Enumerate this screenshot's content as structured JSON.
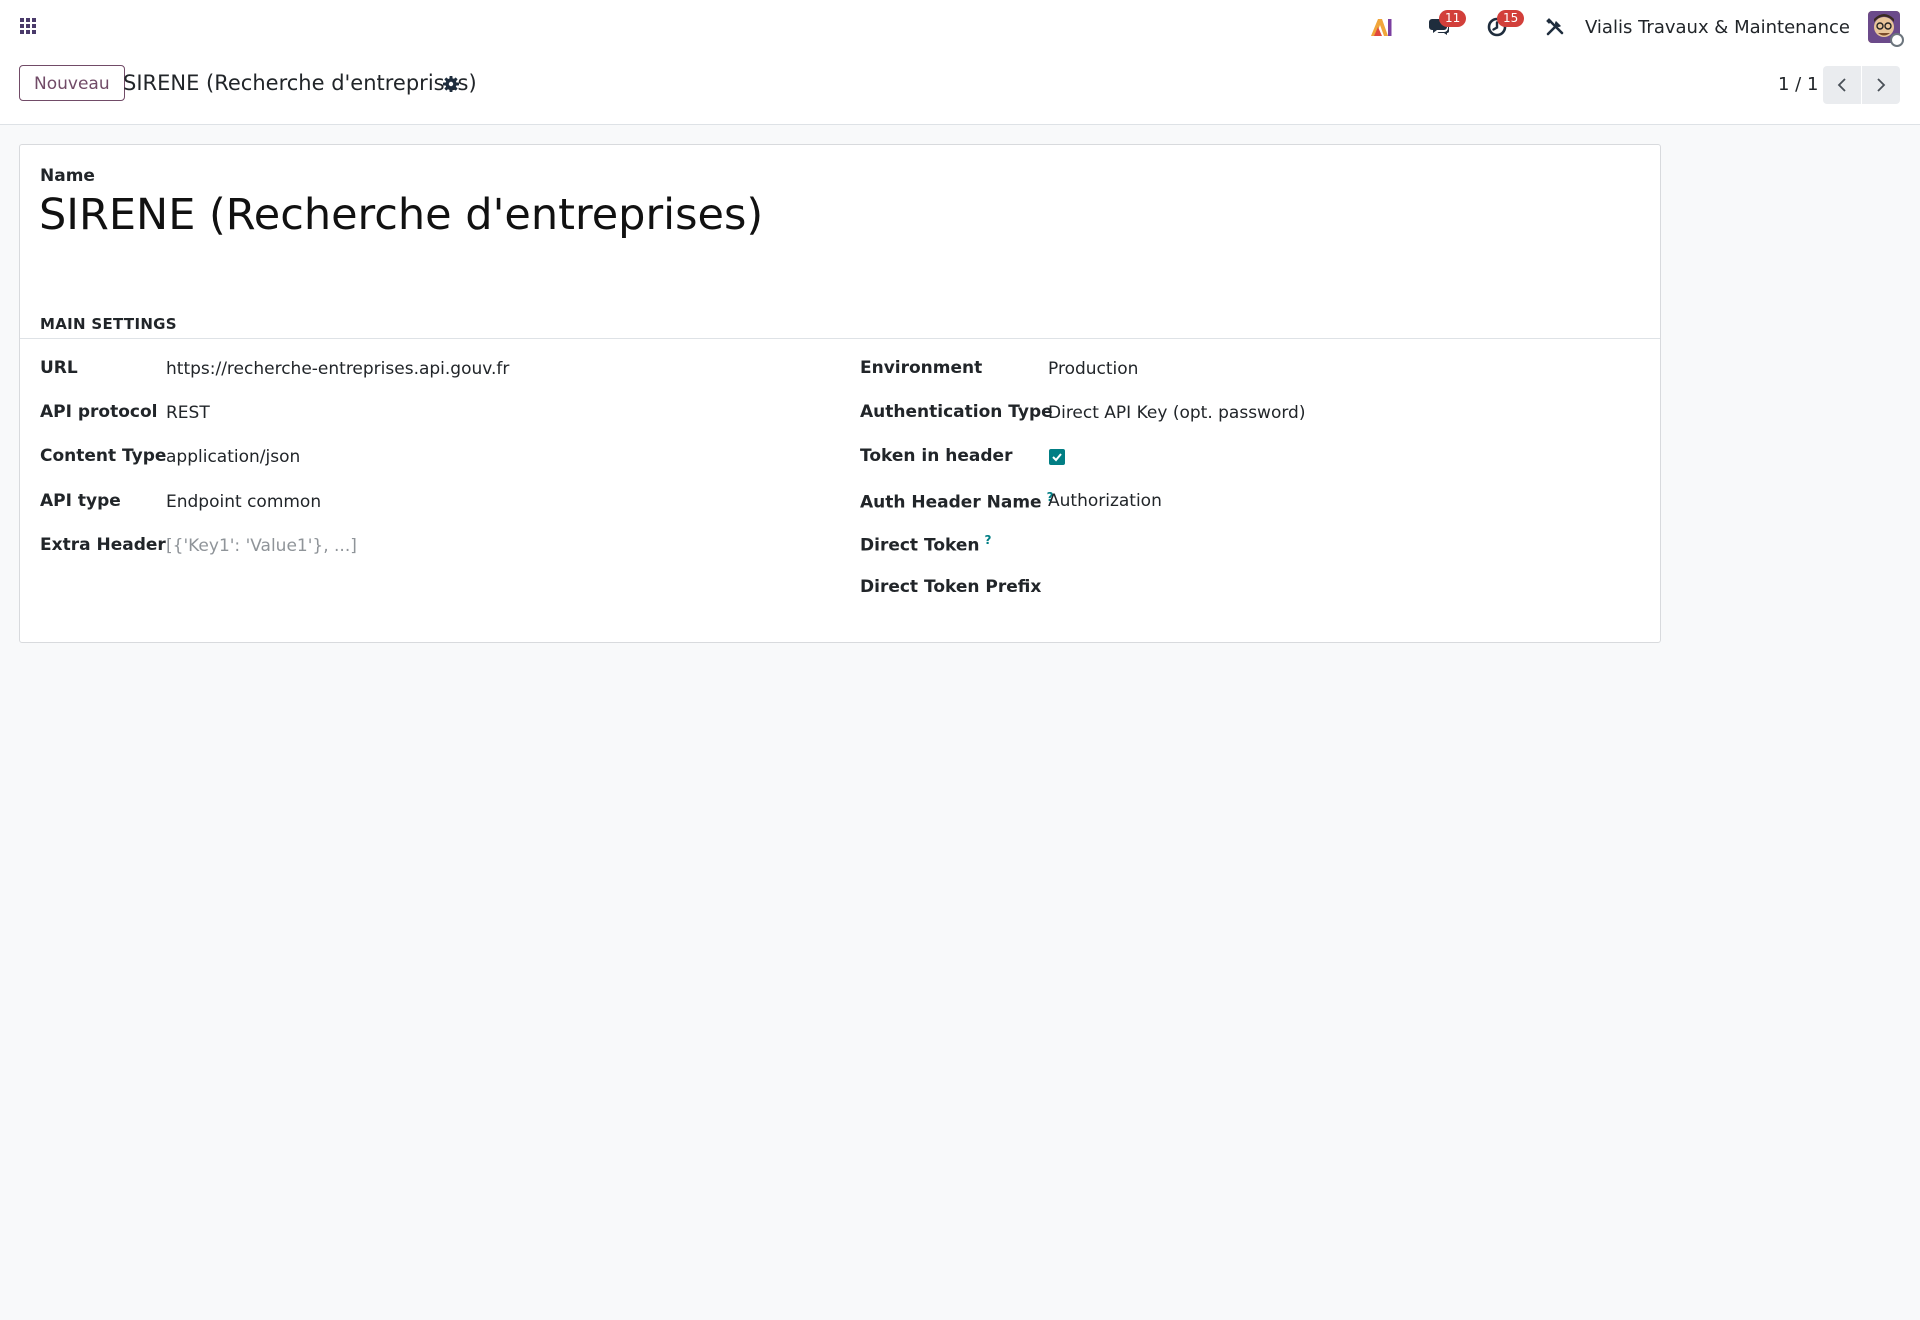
{
  "navbar": {
    "badges": {
      "messages": "11",
      "activities": "15"
    },
    "company_name": "Vialis Travaux & Maintenance",
    "icons": [
      "apps-grid-icon",
      "ai-icon",
      "chat-icon",
      "clock-icon",
      "tools-icon"
    ]
  },
  "control_panel": {
    "new_button": "Nouveau",
    "breadcrumb": "SIRENE (Recherche d'entreprises)",
    "pager": "1 / 1"
  },
  "form": {
    "name_label": "Name",
    "name_value": "SIRENE (Recherche d'entreprises)",
    "section_title": "MAIN SETTINGS",
    "left_fields": [
      {
        "label": "URL",
        "value": "https://recherche-entreprises.api.gouv.fr"
      },
      {
        "label": "API protocol",
        "value": "REST"
      },
      {
        "label": "Content Type",
        "value": "application/json"
      },
      {
        "label": "API type",
        "value": "Endpoint common"
      },
      {
        "label": "Extra Header",
        "placeholder": "[{'Key1': 'Value1'}, ...]"
      }
    ],
    "right_fields": [
      {
        "label": "Environment",
        "value": "Production"
      },
      {
        "label": "Authentication Type",
        "value": "Direct API Key (opt. password)"
      },
      {
        "label": "Token in header",
        "checked": true
      },
      {
        "label": "Auth Header Name",
        "value": "Authorization",
        "help": "?"
      },
      {
        "label": "Direct Token",
        "value": "",
        "help": "?"
      },
      {
        "label": "Direct Token Prefix",
        "value": ""
      }
    ]
  },
  "colors": {
    "brand": "#714b67",
    "accent": "#017e84",
    "badge": "#d23f3a"
  }
}
